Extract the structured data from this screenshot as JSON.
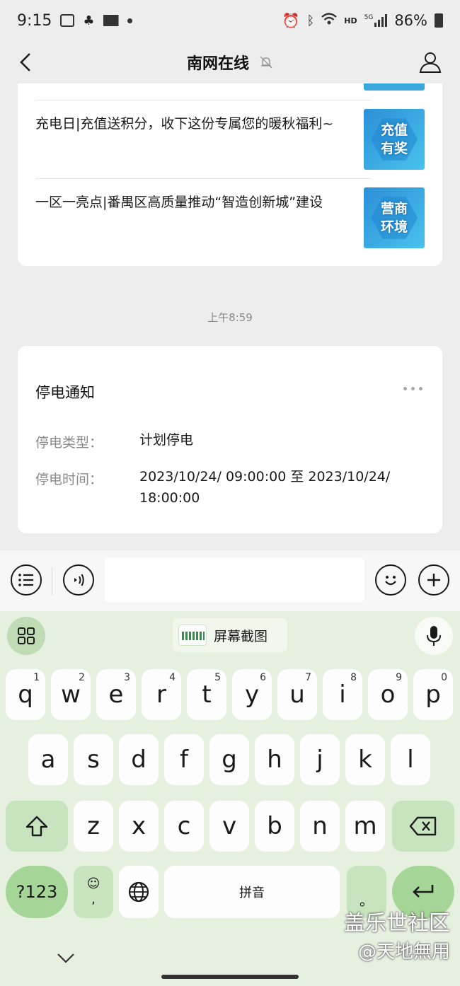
{
  "status_bar": {
    "time": "9:15",
    "network": "HD",
    "signal_label": "5G",
    "battery": "86%"
  },
  "nav": {
    "title": "南网在线"
  },
  "articles": [
    {
      "title": "充电日|充值送积分，收下这份专属您的暖秋福利~",
      "thumb_text": "充值有奖"
    },
    {
      "title": "一区一亮点|番禺区高质量推动“智造创新城”建设",
      "thumb_text": "营商环境"
    }
  ],
  "timestamp": "上午8:59",
  "notice": {
    "title": "停电通知",
    "type_label": "停电类型：",
    "type_value": "计划停电",
    "time_label": "停电时间：",
    "time_value": "2023/10/24/ 09:00:00 至 2023/10/24/ 18:00:00"
  },
  "keyboard": {
    "screenshot_label": "屏幕截图",
    "row1": [
      {
        "k": "q",
        "n": "1"
      },
      {
        "k": "w",
        "n": "2"
      },
      {
        "k": "e",
        "n": "3"
      },
      {
        "k": "r",
        "n": "4"
      },
      {
        "k": "t",
        "n": "5"
      },
      {
        "k": "y",
        "n": "6"
      },
      {
        "k": "u",
        "n": "7"
      },
      {
        "k": "i",
        "n": "8"
      },
      {
        "k": "o",
        "n": "9"
      },
      {
        "k": "p",
        "n": "0"
      }
    ],
    "row2": [
      "a",
      "s",
      "d",
      "f",
      "g",
      "h",
      "j",
      "k",
      "l"
    ],
    "row3": [
      "z",
      "x",
      "c",
      "v",
      "b",
      "n",
      "m"
    ],
    "sym_label": "?123",
    "emoji_label": "☺",
    "comma": ",",
    "space_label": "拼音",
    "period": "。"
  },
  "watermark": {
    "line1": "盖乐世社区",
    "line2": "@天地無用"
  },
  "colors": {
    "keyboard_bg": "#e5f0df",
    "key_fn": "#c7e4be",
    "key_accent": "#a6d598",
    "thumb_blue": "#2d8fd8"
  }
}
